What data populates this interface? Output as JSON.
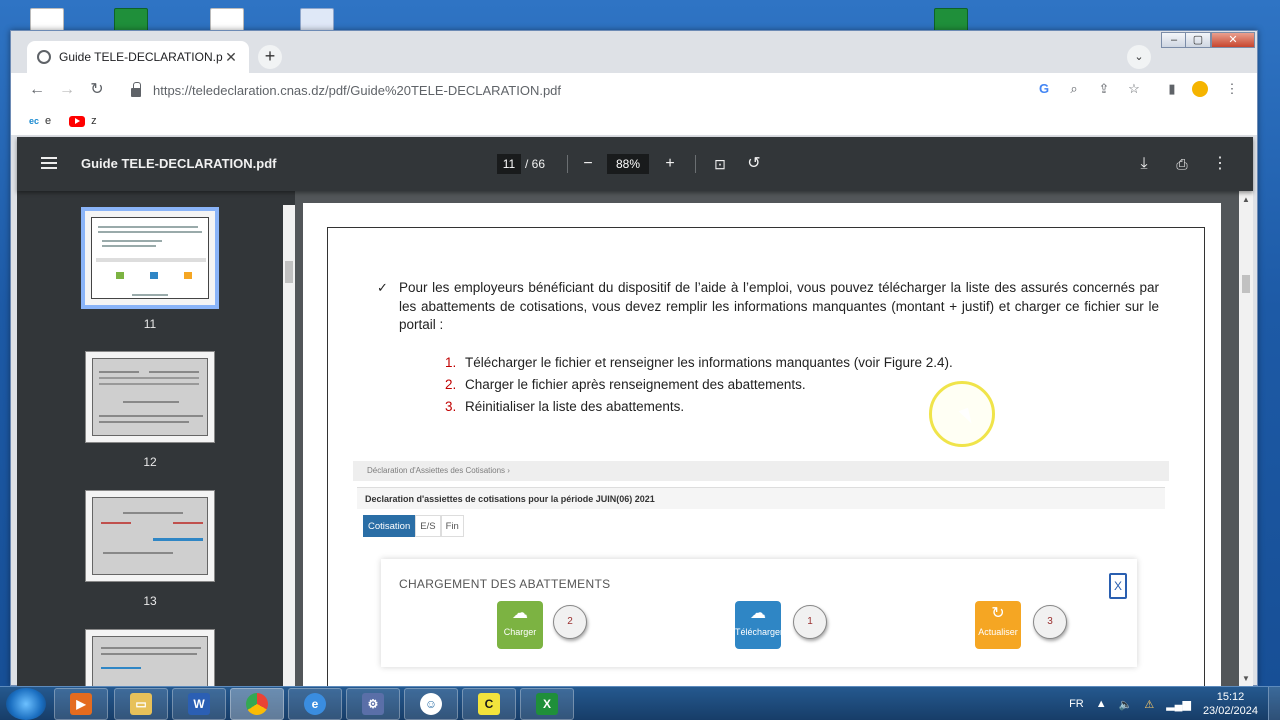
{
  "browser": {
    "tab_title": "Guide TELE-DECLARATION.pdf",
    "tab_close": "✕",
    "new_tab": "+",
    "url": "https://teledeclaration.cnas.dz/pdf/Guide%20TELE-DECLARATION.pdf",
    "bookmarks": [
      {
        "label": "e",
        "icon": "ec-icon"
      },
      {
        "label": "z",
        "icon": "youtube-icon"
      }
    ]
  },
  "pdf": {
    "title": "Guide TELE-DECLARATION.pdf",
    "current_page": "11",
    "page_total": "/ 66",
    "zoom": "88%",
    "thumbnails": [
      {
        "num": "11",
        "selected": true
      },
      {
        "num": "12",
        "selected": false
      },
      {
        "num": "13",
        "selected": false
      }
    ],
    "content": {
      "paragraph": "Pour les employeurs bénéficiant du dispositif de l’aide à l’emploi, vous pouvez télécharger la liste des assurés concernés par les abattements de cotisations, vous devez remplir les informations manquantes (montant + justif) et charger ce fichier sur le portail :",
      "steps": [
        {
          "n": "1.",
          "text": "Télécharger le fichier et renseigner les informations manquantes (voir  Figure 2.4)."
        },
        {
          "n": "2.",
          "text": "Charger le fichier après  renseignement des abattements."
        },
        {
          "n": "3.",
          "text": "Réinitialiser la liste des abattements."
        }
      ],
      "figure": {
        "breadcrumb": "Déclaration d'Assiettes des Cotisations  ›",
        "heading": "Declaration d'assiettes de cotisations pour la période JUIN(06) 2021",
        "tabs": [
          "Cotisation",
          "E/S",
          "Fin"
        ],
        "card_title": "CHARGEMENT DES ABATTEMENTS",
        "buttons": [
          {
            "label": "Charger",
            "badge": "2",
            "color": "#7cb342"
          },
          {
            "label": "Télécharger",
            "badge": "1",
            "color": "#2f86c5"
          },
          {
            "label": "Actualiser",
            "badge": "3",
            "color": "#f5a623"
          }
        ]
      }
    }
  },
  "taskbar": {
    "lang": "FR",
    "time": "15:12",
    "date": "23/02/2024"
  }
}
